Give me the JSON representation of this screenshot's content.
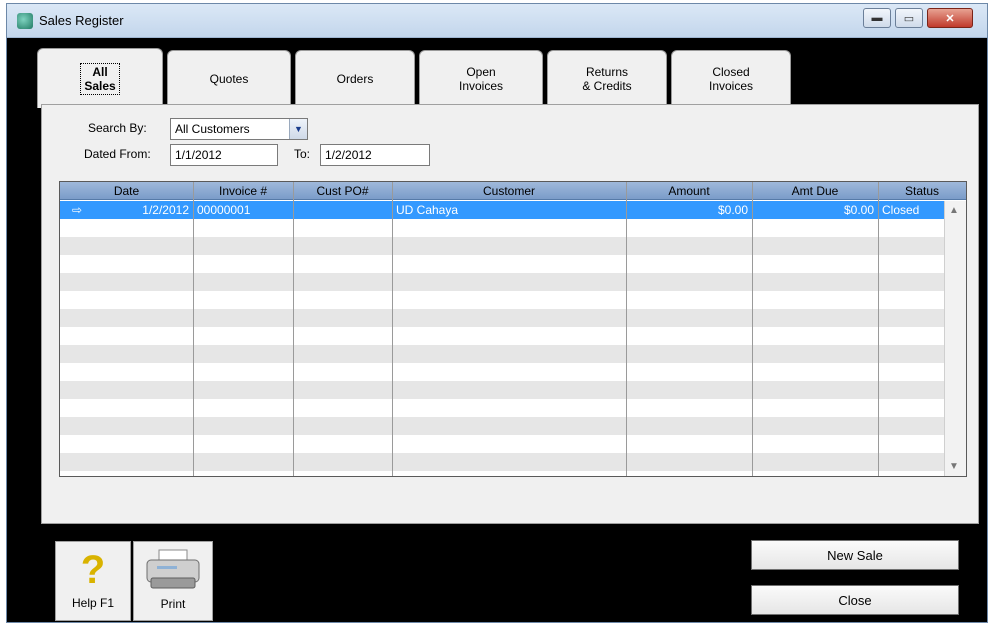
{
  "window": {
    "title": "Sales Register",
    "min_label": "▬",
    "max_label": "▭",
    "close_label": "✕"
  },
  "tabs": [
    {
      "label": "All\nSales",
      "active": true
    },
    {
      "label": "Quotes"
    },
    {
      "label": "Orders"
    },
    {
      "label": "Open\nInvoices"
    },
    {
      "label": "Returns\n& Credits"
    },
    {
      "label": "Closed\nInvoices"
    }
  ],
  "search": {
    "search_by_label": "Search By:",
    "search_by_value": "All Customers",
    "dated_from_label": "Dated From:",
    "dated_from_value": "1/1/2012",
    "to_label": "To:",
    "to_value": "1/2/2012"
  },
  "table": {
    "columns": [
      "Date",
      "Invoice #",
      "Cust PO#",
      "Customer",
      "Amount",
      "Amt Due",
      "Status"
    ],
    "rows": [
      {
        "date": "1/2/2012",
        "invoice": "00000001",
        "cust_po": "",
        "customer": "UD Cahaya",
        "amount": "$0.00",
        "amt_due": "$0.00",
        "status": "Closed"
      }
    ]
  },
  "toolbar": {
    "help_label": "Help F1",
    "print_label": "Print"
  },
  "buttons": {
    "new_sale": "New Sale",
    "close": "Close"
  }
}
